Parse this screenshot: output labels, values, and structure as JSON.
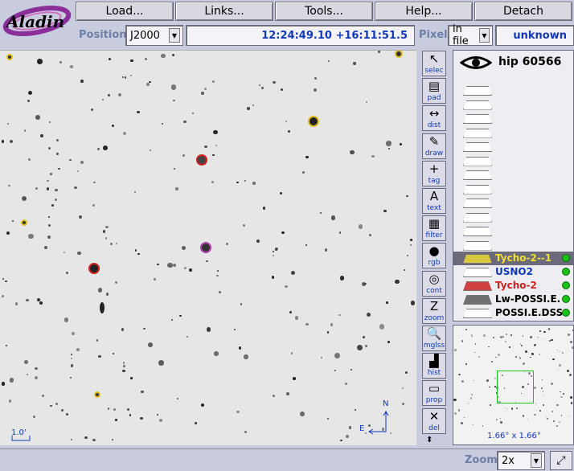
{
  "app": {
    "logo_text": "Aladin"
  },
  "menu": [
    "Load...",
    "Links...",
    "Tools...",
    "Help...",
    "Detach"
  ],
  "position_row": {
    "position_label": "Position",
    "frame": "J2000",
    "coordinates": "12:24:49.10 +16:11:51.5",
    "pixel_label": "Pixel",
    "pixel_mode": "in file",
    "pixel_value": "unknown"
  },
  "view": {
    "scale_label": "1.0'",
    "compass_north": "N",
    "compass_east": "E"
  },
  "tools": [
    {
      "label": "selec",
      "icon": "arrow-pointer-icon"
    },
    {
      "label": "pad",
      "icon": "notepad-icon"
    },
    {
      "label": "dist",
      "icon": "distance-icon"
    },
    {
      "label": "draw",
      "icon": "pencil-icon"
    },
    {
      "label": "tag",
      "icon": "crosshair-icon"
    },
    {
      "label": "text",
      "icon": "text-icon"
    },
    {
      "label": "filter",
      "icon": "filter-icon"
    },
    {
      "label": "rgb",
      "icon": "rgb-icon"
    },
    {
      "label": "cont",
      "icon": "contour-icon"
    },
    {
      "label": "zoom",
      "icon": "zoom-icon"
    },
    {
      "label": "mglss",
      "icon": "magnifier-icon"
    },
    {
      "label": "hist",
      "icon": "histogram-icon"
    },
    {
      "label": "prop",
      "icon": "properties-icon"
    },
    {
      "label": "del",
      "icon": "delete-icon"
    }
  ],
  "stack": {
    "target": "hip 60566",
    "layers": [
      {
        "name": "Tycho-2--1",
        "color": "#f0e030"
      },
      {
        "name": "USNO2",
        "color": "#1038b8"
      },
      {
        "name": "Tycho-2",
        "color": "#d02020"
      },
      {
        "name": "Lw-POSSI.E.",
        "color": "#000000"
      },
      {
        "name": "POSSI.E.DSS",
        "color": "#000000"
      }
    ]
  },
  "thumbnail": {
    "fov_label": "1.66° x 1.66°"
  },
  "zoom": {
    "label": "Zoom",
    "value": "2x"
  },
  "colors": {
    "accent": "#1038b8",
    "label_color": "#6f7fa5",
    "ok_green": "#18c018"
  }
}
